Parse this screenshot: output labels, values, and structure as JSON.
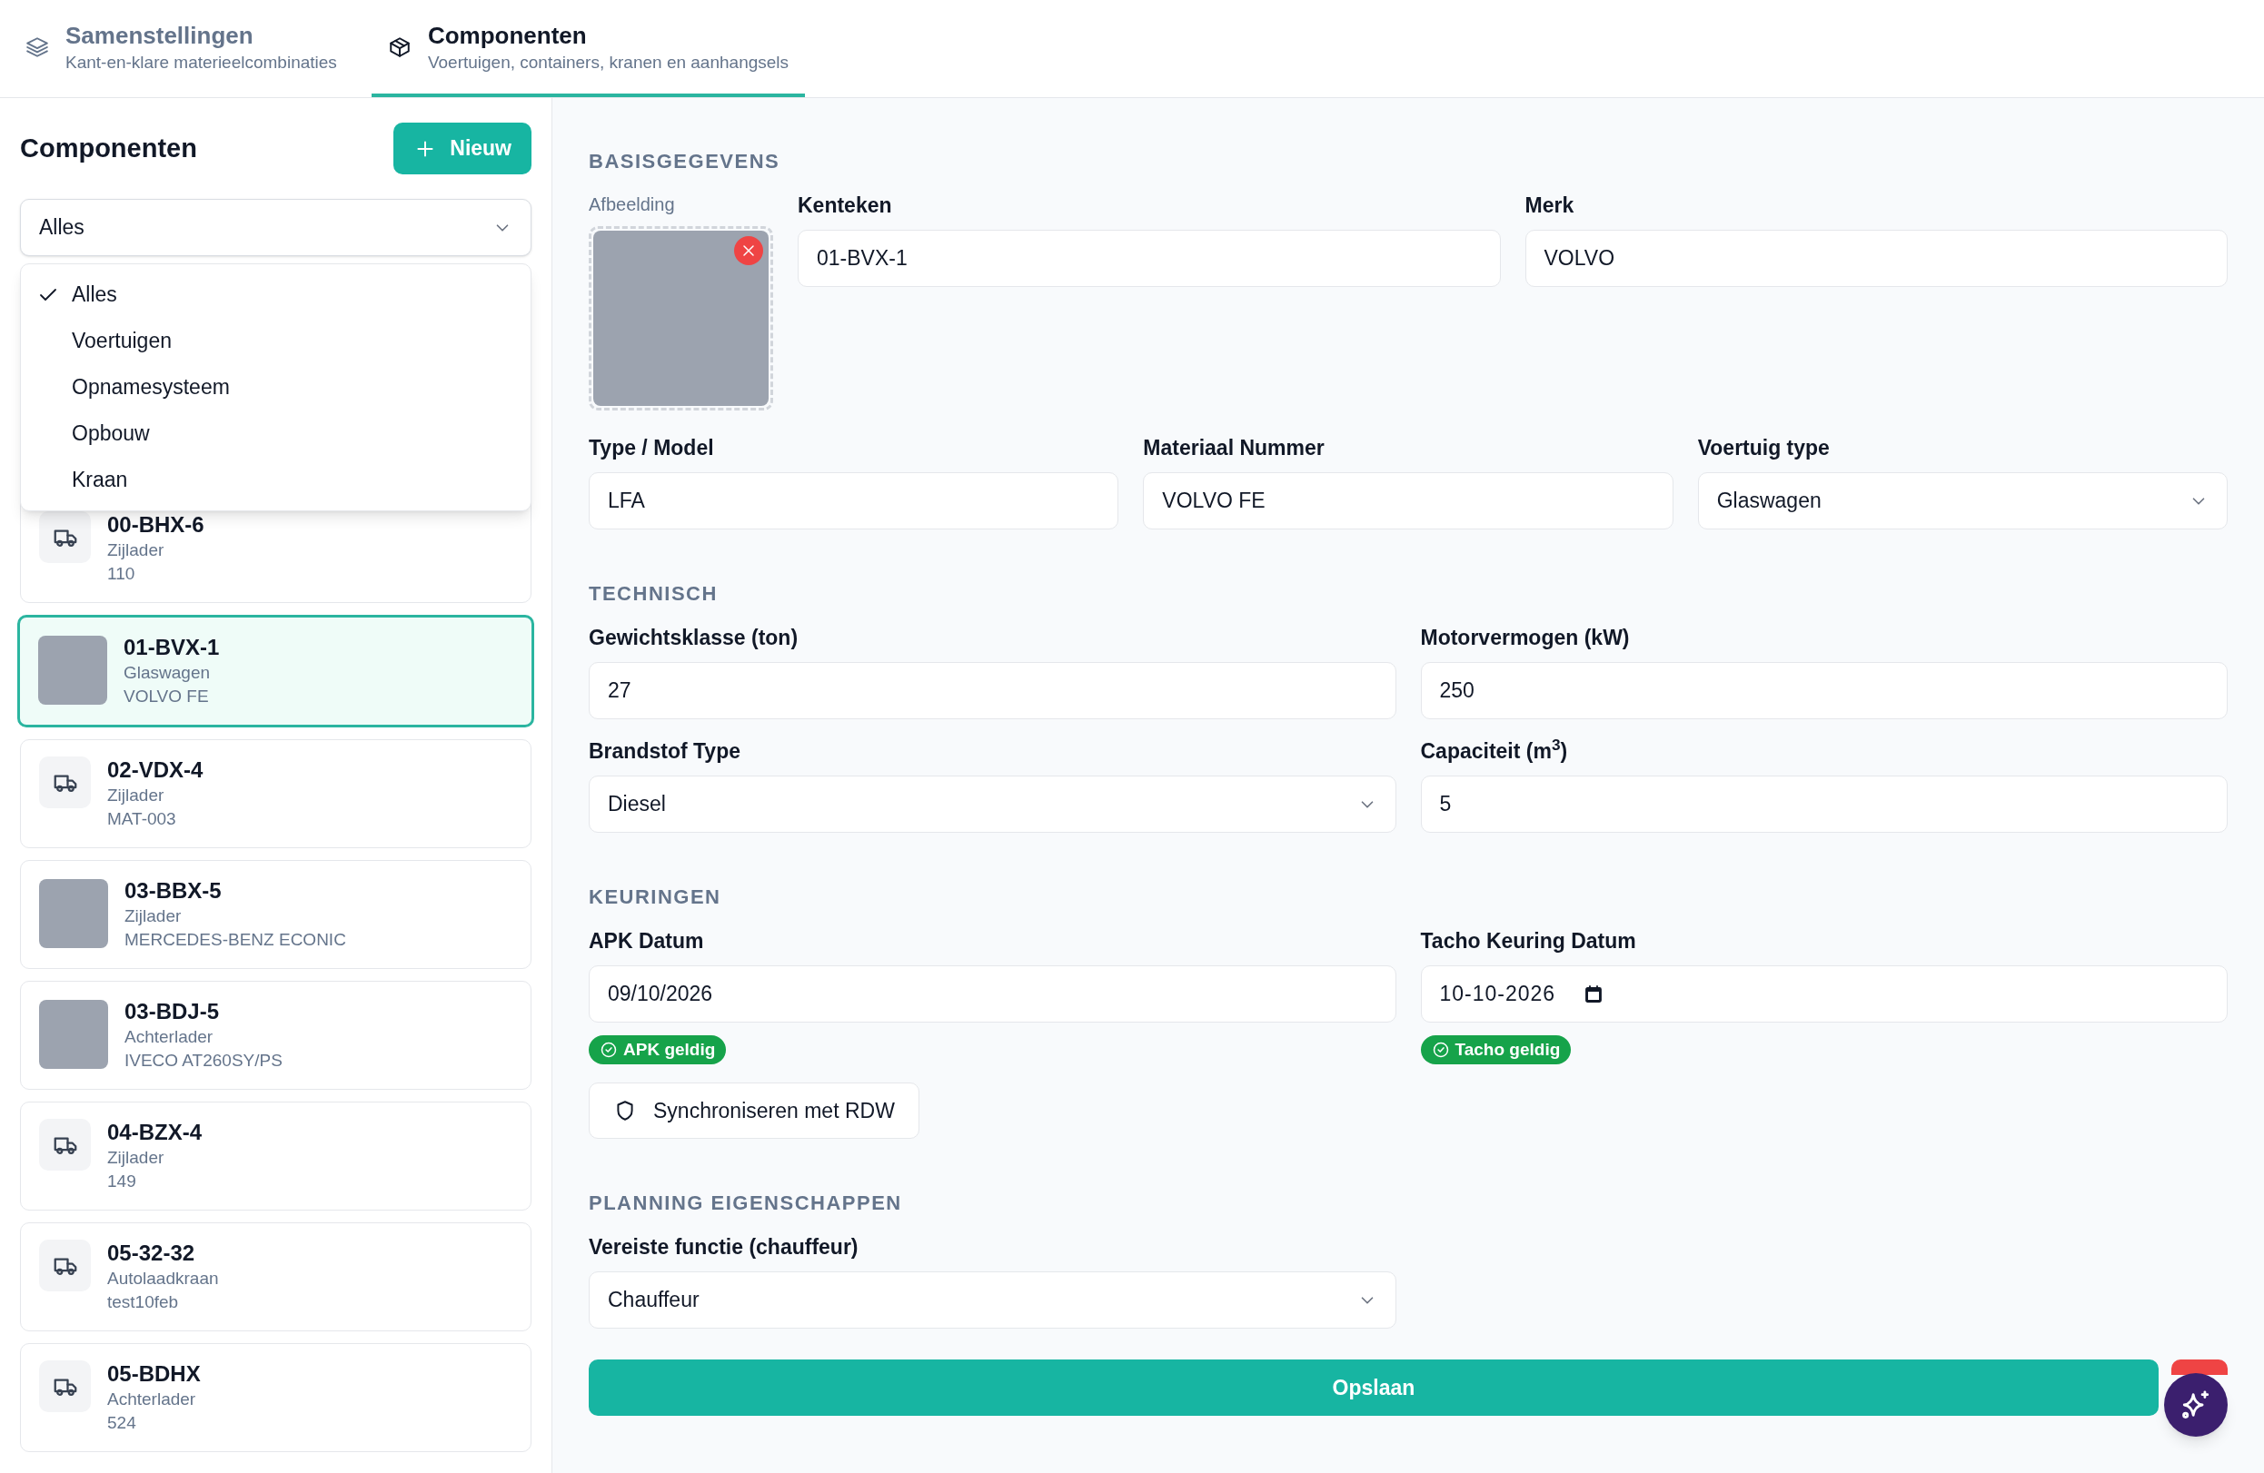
{
  "tabs": [
    {
      "title": "Samenstellingen",
      "subtitle": "Kant-en-klare materieelcombinaties",
      "selected": false
    },
    {
      "title": "Componenten",
      "subtitle": "Voertuigen, containers, kranen en aanhangsels",
      "selected": true
    }
  ],
  "sidebar": {
    "title": "Componenten",
    "new_button": "Nieuw",
    "filter": {
      "value": "Alles",
      "expanded": true,
      "options": [
        {
          "label": "Alles",
          "selected": true
        },
        {
          "label": "Voertuigen",
          "selected": false
        },
        {
          "label": "Opnamesysteem",
          "selected": false
        },
        {
          "label": "Opbouw",
          "selected": false
        },
        {
          "label": "Kraan",
          "selected": false
        }
      ]
    },
    "items": [
      {
        "plate": "00-BHX-6",
        "type": "Zijlader",
        "detail": "110",
        "photo": false,
        "selected": false
      },
      {
        "plate": "01-BVX-1",
        "type": "Glaswagen",
        "detail": "VOLVO FE",
        "photo": true,
        "selected": true
      },
      {
        "plate": "02-VDX-4",
        "type": "Zijlader",
        "detail": "MAT-003",
        "photo": false,
        "selected": false
      },
      {
        "plate": "03-BBX-5",
        "type": "Zijlader",
        "detail": "MERCEDES-BENZ ECONIC",
        "photo": true,
        "selected": false
      },
      {
        "plate": "03-BDJ-5",
        "type": "Achterlader",
        "detail": "IVECO AT260SY/PS",
        "photo": true,
        "selected": false
      },
      {
        "plate": "04-BZX-4",
        "type": "Zijlader",
        "detail": "149",
        "photo": false,
        "selected": false
      },
      {
        "plate": "05-32-32",
        "type": "Autolaadkraan",
        "detail": "test10feb",
        "photo": false,
        "selected": false
      },
      {
        "plate": "05-BDHX",
        "type": "Achterlader",
        "detail": "524",
        "photo": false,
        "selected": false
      }
    ]
  },
  "form": {
    "sections": [
      {
        "title": "BASISGEGEVENS",
        "rows": [
          [
            {
              "kind": "image",
              "label": "Afbeelding",
              "removable": true
            },
            {
              "kind": "text",
              "label": "Kenteken",
              "value": "01-BVX-1"
            },
            {
              "kind": "text",
              "label": "Merk",
              "value": "VOLVO"
            }
          ],
          [
            {
              "kind": "text",
              "label": "Type / Model",
              "value": "LFA"
            },
            {
              "kind": "text",
              "label": "Materiaal Nummer",
              "value": "VOLVO FE"
            },
            {
              "kind": "select",
              "label": "Voertuig type",
              "value": "Glaswagen"
            }
          ]
        ]
      },
      {
        "title": "TECHNISCH",
        "rows": [
          [
            {
              "kind": "text",
              "label": "Gewichtsklasse (ton)",
              "value": "27"
            },
            {
              "kind": "text",
              "label": "Motorvermogen (kW)",
              "value": "250"
            }
          ],
          [
            {
              "kind": "select",
              "label": "Brandstof Type",
              "value": "Diesel"
            },
            {
              "kind": "text",
              "label": "Capaciteit (m$^{3}$)",
              "value": "5"
            }
          ]
        ]
      },
      {
        "title": "KEURINGEN",
        "rows": [
          [
            {
              "kind": "date",
              "label": "APK Datum",
              "value": "09/10/2026",
              "picker": false,
              "badge": "APK geldig"
            },
            {
              "kind": "date",
              "label": "Tacho Keuring Datum",
              "value": "10-10-2026",
              "picker": true,
              "badge": "Tacho geldig"
            }
          ],
          [
            {
              "kind": "button",
              "label": "Synchroniseren met RDW"
            }
          ]
        ]
      },
      {
        "title": "PLANNING EIGENSCHAPPEN",
        "rows": [
          [
            {
              "kind": "select",
              "label": "Vereiste functie (chauffeur)",
              "value": "Chauffeur"
            }
          ]
        ]
      }
    ],
    "save_button": "Opslaan"
  }
}
